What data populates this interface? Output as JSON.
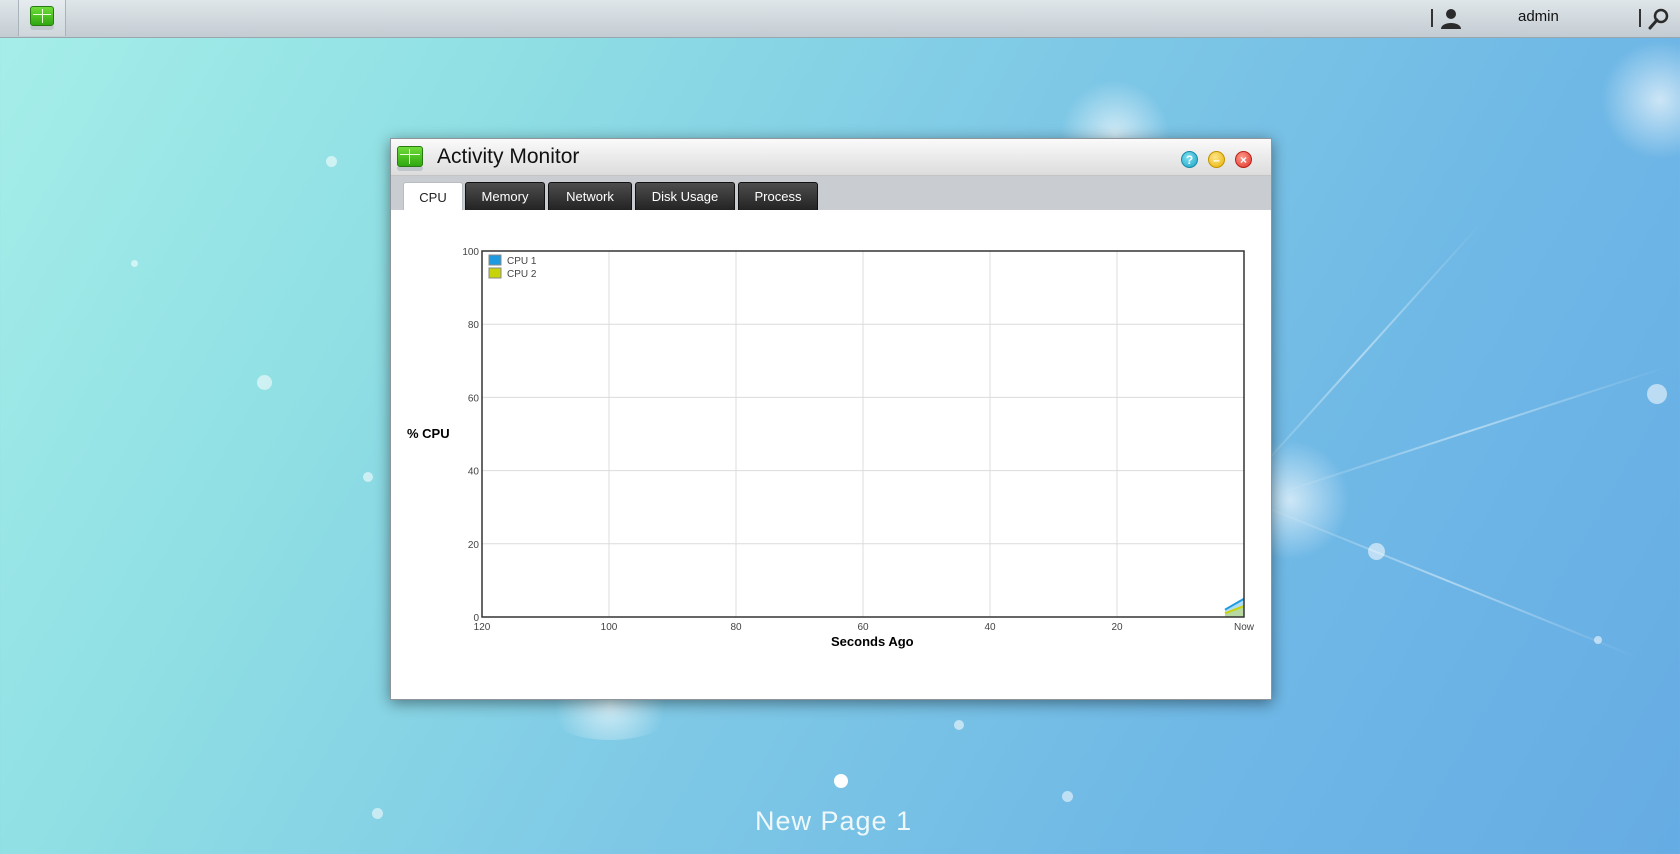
{
  "topbar": {
    "app_icon": "activity-monitor-icon",
    "user_icon": "user-icon",
    "username": "admin",
    "search_icon": "search-icon"
  },
  "window": {
    "title": "Activity Monitor",
    "icon": "activity-monitor-icon",
    "controls": {
      "help": "help-icon",
      "minimize": "minimize-icon",
      "close": "close-icon"
    },
    "tabs": [
      {
        "label": "CPU",
        "active": true
      },
      {
        "label": "Memory",
        "active": false
      },
      {
        "label": "Network",
        "active": false
      },
      {
        "label": "Disk Usage",
        "active": false
      },
      {
        "label": "Process",
        "active": false
      }
    ]
  },
  "chart_data": {
    "type": "area",
    "ylabel": "% CPU",
    "xlabel": "Seconds Ago",
    "ylim": [
      0,
      100
    ],
    "yticks": [
      "0",
      "20",
      "40",
      "60",
      "80",
      "100"
    ],
    "xticks": [
      "120",
      "100",
      "80",
      "60",
      "40",
      "20",
      "Now"
    ],
    "x": [
      120,
      0
    ],
    "grid": true,
    "legend_position": "top-left",
    "series": [
      {
        "name": "CPU 1",
        "color": "#1e9be0",
        "x": [
          3,
          0
        ],
        "values": [
          2,
          5
        ]
      },
      {
        "name": "CPU 2",
        "color": "#c8d40a",
        "x": [
          3,
          0
        ],
        "values": [
          1,
          3
        ]
      }
    ]
  },
  "desktop": {
    "page_label": "New Page 1"
  }
}
